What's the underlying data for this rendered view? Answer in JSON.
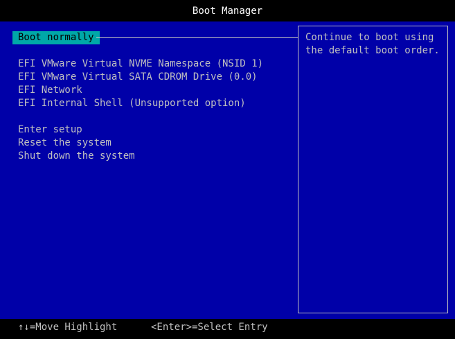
{
  "title": "Boot Manager",
  "menu": {
    "items": [
      {
        "label": "Boot normally"
      },
      {
        "label": "EFI VMware Virtual NVME Namespace (NSID 1)"
      },
      {
        "label": "EFI VMware Virtual SATA CDROM Drive (0.0)"
      },
      {
        "label": "EFI Network"
      },
      {
        "label": "EFI Internal Shell (Unsupported option)"
      },
      {
        "label": "Enter setup"
      },
      {
        "label": "Reset the system"
      },
      {
        "label": "Shut down the system"
      }
    ],
    "selected_index": 0
  },
  "help": {
    "lines": [
      "Continue to boot using",
      "the default boot order."
    ]
  },
  "status": {
    "move_hint": "↑↓=Move Highlight",
    "select_hint": "<Enter>=Select Entry"
  },
  "colors": {
    "background": "#0000a8",
    "highlight": "#00a8a8",
    "text": "#c0c0c0",
    "title_text": "#ffffff"
  }
}
